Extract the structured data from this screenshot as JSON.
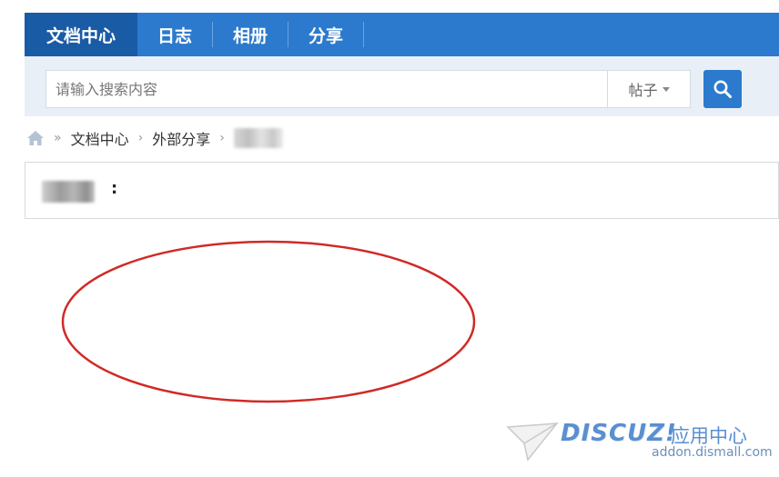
{
  "nav": {
    "items": [
      {
        "label": "文档中心",
        "active": true
      },
      {
        "label": "日志",
        "active": false
      },
      {
        "label": "相册",
        "active": false
      },
      {
        "label": "分享",
        "active": false
      }
    ]
  },
  "search": {
    "placeholder": "请输入搜索内容",
    "value": "",
    "type_label": "帖子",
    "button_icon": "search-icon"
  },
  "breadcrumb": {
    "home_icon": "home-icon",
    "home_separator": "»",
    "items": [
      "文档中心",
      "外部分享"
    ],
    "separator": "›"
  },
  "post": {
    "title_suffix": ":"
  },
  "watermark": {
    "brand": "DISCUZ!",
    "subtitle": "应用中心",
    "url": "addon.dismall.com"
  },
  "colors": {
    "nav_bg": "#2b7acd",
    "nav_active_bg": "#1a5ba6",
    "search_area_bg": "#e9eff6",
    "annotation": "#d02a26"
  }
}
